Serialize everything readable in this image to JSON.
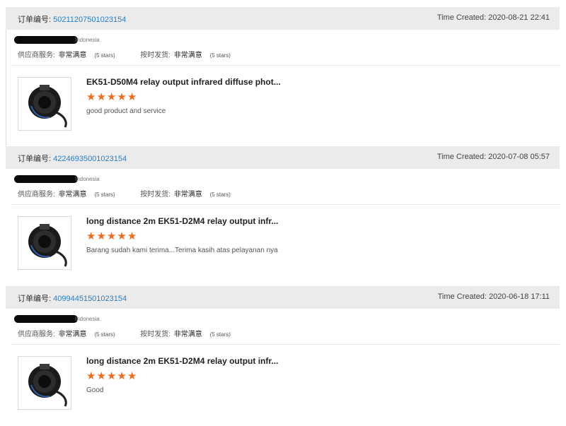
{
  "labels": {
    "order_no": "订单编号:",
    "time_created": "Time Created:",
    "supplier_service": "供应商服务:",
    "on_time": "按时发货:",
    "very_satisfied": "非常满意",
    "five_stars": "(5 stars)",
    "country": "Indonesia"
  },
  "orders": [
    {
      "order_number": "50211207501023154",
      "time_created": "2020-08-21 22:41",
      "product_name": "EK51-D50M4 relay output infrared diffuse phot...",
      "rating": 5,
      "review": "good product and service"
    },
    {
      "order_number": "42246935001023154",
      "time_created": "2020-07-08 05:57",
      "product_name": "long distance 2m EK51-D2M4 relay output infr...",
      "rating": 5,
      "review": "Barang sudah kami terima...Terima kasih atas pelayanan nya"
    },
    {
      "order_number": "40994451501023154",
      "time_created": "2020-06-18 17:11",
      "product_name": "long distance 2m EK51-D2M4 relay output infr...",
      "rating": 5,
      "review": "Good"
    }
  ],
  "colors": {
    "star": "#ef6b1e",
    "link": "#2b7fc4",
    "header_bg": "#ebebeb"
  },
  "icons": {
    "star": "star-icon",
    "product": "sensor-product-image"
  }
}
